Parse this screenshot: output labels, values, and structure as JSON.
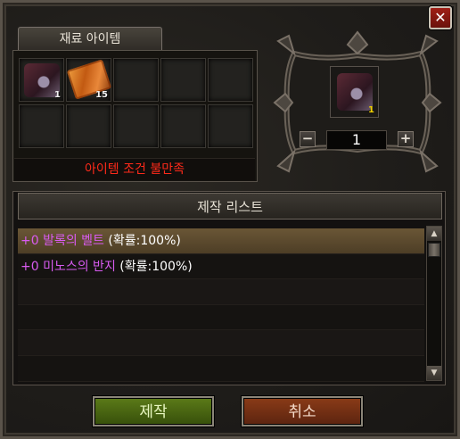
{
  "window": {
    "close_glyph": "✕"
  },
  "materials": {
    "tab_label": "재료 아이템",
    "slots": [
      {
        "icon": "belt-icon",
        "qty": "1"
      },
      {
        "icon": "scroll-icon",
        "qty": "15"
      },
      {
        "icon": "",
        "qty": ""
      },
      {
        "icon": "",
        "qty": ""
      },
      {
        "icon": "",
        "qty": ""
      },
      {
        "icon": "",
        "qty": ""
      },
      {
        "icon": "",
        "qty": ""
      },
      {
        "icon": "",
        "qty": ""
      },
      {
        "icon": "",
        "qty": ""
      },
      {
        "icon": "",
        "qty": ""
      }
    ],
    "condition_text": "아이템 조건 불만족"
  },
  "result": {
    "icon": "belt-icon",
    "qty": "1",
    "minus_label": "−",
    "plus_label": "+",
    "quantity": "1"
  },
  "craft_list": {
    "header": "제작 리스트",
    "rows": [
      {
        "name": "+0 발록의 벨트",
        "rate": " (확률:100%)",
        "selected": true
      },
      {
        "name": "+0 미노스의 반지",
        "rate": " (확률:100%)",
        "selected": false
      },
      {
        "name": "",
        "rate": "",
        "selected": false
      },
      {
        "name": "",
        "rate": "",
        "selected": false
      },
      {
        "name": "",
        "rate": "",
        "selected": false
      },
      {
        "name": "",
        "rate": "",
        "selected": false
      }
    ],
    "scroll_up": "▲",
    "scroll_down": "▼"
  },
  "buttons": {
    "craft_label": "제작",
    "cancel_label": "취소"
  },
  "colors": {
    "condition_text": "#ff2a1a",
    "item_name": "#d85bf0",
    "result_qty": "#f0d000"
  }
}
